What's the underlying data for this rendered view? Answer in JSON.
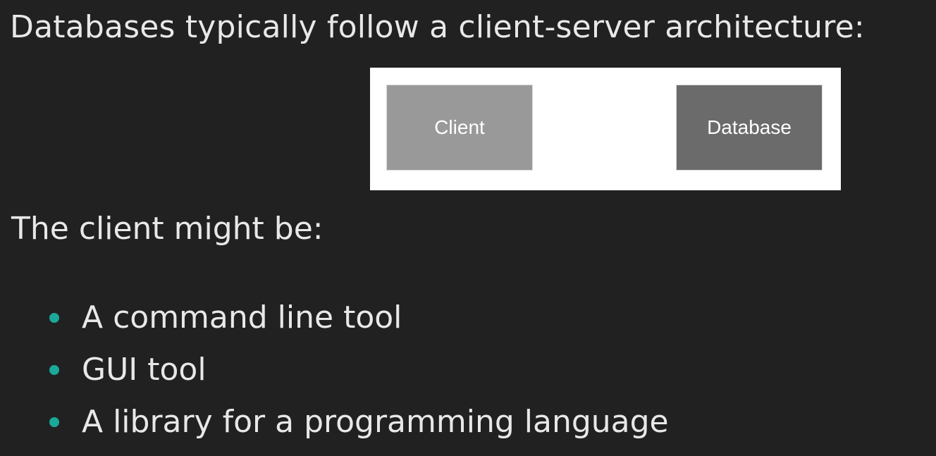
{
  "intro": {
    "text": "Databases typically follow a client-server architecture:"
  },
  "diagram": {
    "client_label": "Client",
    "database_label": "Database"
  },
  "subhead": {
    "text": "The client might be:"
  },
  "bullets": [
    {
      "label": "A command line tool"
    },
    {
      "label": "GUI tool"
    },
    {
      "label": "A library for a programming language"
    }
  ],
  "colors": {
    "background": "#212121",
    "text": "#e8e8e8",
    "bullet_accent": "#1aa99a",
    "client_box": "#999999",
    "database_box": "#6b6b6b"
  }
}
